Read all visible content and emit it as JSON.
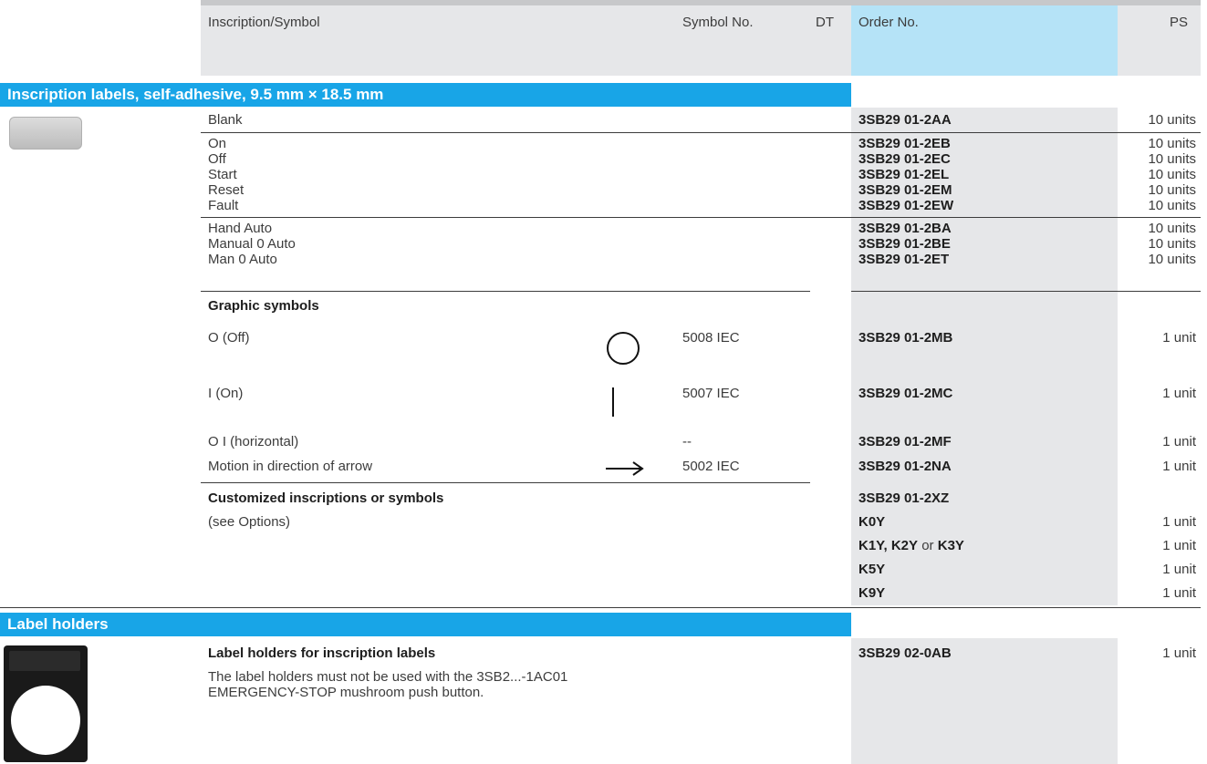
{
  "header": {
    "inscription": "Inscription/Symbol",
    "symbol_no": "Symbol No.",
    "dt": "DT",
    "order_no": "Order No.",
    "ps": "PS"
  },
  "section1": {
    "title": "Inscription labels, self-adhesive, 9.5 mm × 18.5 mm",
    "blank": {
      "label": "Blank",
      "order": "3SB29 01-2AA",
      "ps": "10 units"
    },
    "group1": [
      {
        "label": "On",
        "order": "3SB29 01-2EB",
        "ps": "10 units"
      },
      {
        "label": "Off",
        "order": "3SB29 01-2EC",
        "ps": "10 units"
      },
      {
        "label": "Start",
        "order": "3SB29 01-2EL",
        "ps": "10 units"
      },
      {
        "label": "Reset",
        "order": "3SB29 01-2EM",
        "ps": "10 units"
      },
      {
        "label": "Fault",
        "order": "3SB29 01-2EW",
        "ps": "10 units"
      }
    ],
    "group2": [
      {
        "label": "Hand Auto",
        "order": "3SB29 01-2BA",
        "ps": "10 units"
      },
      {
        "label": "Manual 0 Auto",
        "order": "3SB29 01-2BE",
        "ps": "10 units"
      },
      {
        "label": "Man 0 Auto",
        "order": "3SB29 01-2ET",
        "ps": "10 units"
      }
    ],
    "graphic_heading": "Graphic symbols",
    "graphic": [
      {
        "label": "O (Off)",
        "symbol_no": "5008 IEC",
        "order": "3SB29 01-2MB",
        "ps": "1 unit",
        "icon": "circle-icon"
      },
      {
        "label": "I (On)",
        "symbol_no": "5007 IEC",
        "order": "3SB29 01-2MC",
        "ps": "1 unit",
        "icon": "vertical-bar-icon"
      },
      {
        "label": "O I (horizontal)",
        "symbol_no": "--",
        "order": "3SB29 01-2MF",
        "ps": "1 unit"
      },
      {
        "label": "Motion in direction of arrow",
        "symbol_no": "5002 IEC",
        "order": "3SB29 01-2NA",
        "ps": "1 unit",
        "icon": "arrow-right-icon"
      }
    ],
    "custom_heading": "Customized inscriptions or symbols",
    "custom_order": "3SB29 01-2XZ",
    "custom_note": "(see Options)",
    "custom_options": [
      {
        "order": "K0Y",
        "ps": "1 unit"
      },
      {
        "order_bold_a": "K1Y, K2Y",
        "order_or": " or ",
        "order_bold_b": "K3Y",
        "ps": "1 unit"
      },
      {
        "order": "K5Y",
        "ps": "1 unit"
      },
      {
        "order": "K9Y",
        "ps": "1 unit"
      }
    ]
  },
  "section2": {
    "title": "Label holders",
    "heading": "Label holders for inscription labels",
    "note_line1": "The label holders must not be used with the 3SB2...-1AC01",
    "note_line2": "EMERGENCY-STOP mushroom push button.",
    "order": "3SB29 02-0AB",
    "ps": "1 unit"
  },
  "colors": {
    "section_bar": "#18a5e7",
    "order_header": "#b5e3f7",
    "order_column": "#e6e7e9"
  }
}
